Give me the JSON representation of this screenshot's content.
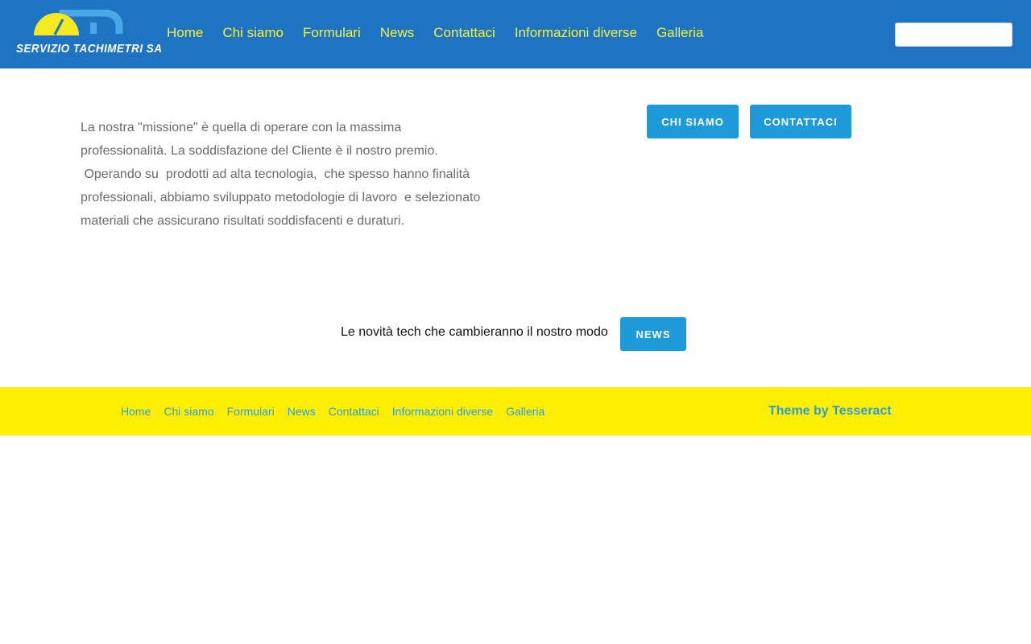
{
  "header": {
    "logo_text": "SERVIZIO TACHIMETRI SA",
    "nav": [
      "Home",
      "Chi siamo",
      "Formulari",
      "News",
      "Contattaci",
      "Informazioni diverse",
      "Galleria"
    ],
    "search_value": ""
  },
  "main": {
    "mission_lines": [
      "La nostra \"missione\" è quella di operare con la massima",
      "professionalità. La soddisfazione del Cliente è il nostro premio.",
      " Operando su  prodotti ad alta tecnologia,  che spesso hanno finalità",
      "professionali, abbiamo sviluppato metodologie di lavoro  e selezionato",
      "materiali che assicurano risultati soddisfacenti e duraturi."
    ],
    "btn_chi_siamo": "CHI SIAMO",
    "btn_contattaci": "CONTATTACI",
    "news_text": "Le novità tech che cambieranno il nostro modo",
    "btn_news": "NEWS"
  },
  "footer": {
    "nav": [
      "Home",
      "Chi siamo",
      "Formulari",
      "News",
      "Contattaci",
      "Informazioni diverse",
      "Galleria"
    ],
    "theme_prefix": "Theme by",
    "theme_name": "Tesseract"
  },
  "colors": {
    "header_bg": "#1e74c2",
    "nav_text": "#f5f03a",
    "button_bg": "#1e9ad8",
    "footer_bg": "#fff000",
    "footer_link": "#2a9fd6"
  },
  "icons": {
    "logo": "speedometer-logo"
  }
}
